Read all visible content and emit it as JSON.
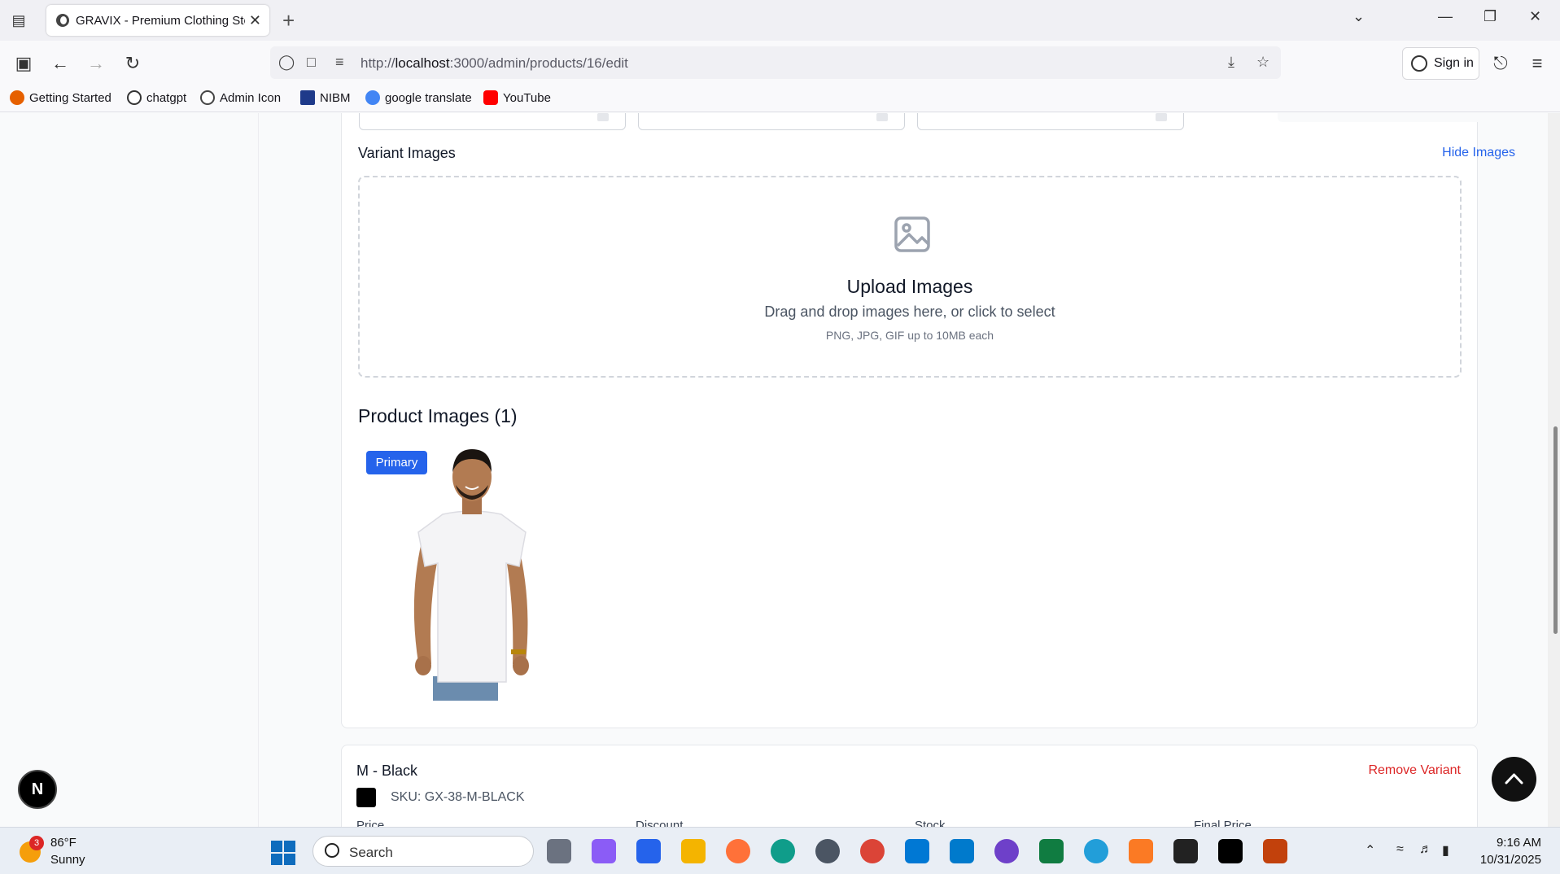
{
  "browser": {
    "tab_title": "GRAVIX - Premium Clothing Sto",
    "url_prefix": "http://",
    "url_host": "localhost",
    "url_path": ":3000/admin/products/16/edit",
    "sign_in": "Sign in",
    "bookmarks": [
      {
        "label": "Getting Started",
        "icon": "firefox-icon",
        "color": "#e66000"
      },
      {
        "label": "chatgpt",
        "icon": "openai-icon",
        "color": "#333333"
      },
      {
        "label": "Admin Icon",
        "icon": "globe-icon",
        "color": "#444444"
      },
      {
        "label": "NIBM",
        "icon": "nibm-icon",
        "color": "#1e3a8a"
      },
      {
        "label": "google translate",
        "icon": "google-icon",
        "color": "#4285f4"
      },
      {
        "label": "YouTube",
        "icon": "youtube-icon",
        "color": "#ff0000"
      }
    ]
  },
  "page": {
    "variant_images_title": "Variant Images",
    "hide_images_link": "Hide Images",
    "dropzone": {
      "title": "Upload Images",
      "subtitle": "Drag and drop images here, or click to select",
      "note": "PNG, JPG, GIF up to 10MB each"
    },
    "product_images_title": "Product Images (1)",
    "primary_badge": "Primary",
    "variant": {
      "name": "M - Black",
      "remove_link": "Remove Variant",
      "sku": "SKU: GX-38-M-BLACK",
      "swatch_color": "#000000",
      "columns": [
        "Price",
        "Discount",
        "Stock",
        "Final Price"
      ]
    },
    "next_badge": "N"
  },
  "taskbar": {
    "weather_badge": "3",
    "temperature": "86°F",
    "condition": "Sunny",
    "search_label": "Search",
    "time": "9:16 AM",
    "date": "10/31/2025",
    "apps": [
      {
        "name": "task-view-icon",
        "color": "#6b7280"
      },
      {
        "name": "copilot-icon",
        "color": "#8b5cf6"
      },
      {
        "name": "store-icon",
        "color": "#2563eb"
      },
      {
        "name": "file-explorer-icon",
        "color": "#f4b400"
      },
      {
        "name": "firefox-icon",
        "color": "#ff7139"
      },
      {
        "name": "edge-icon",
        "color": "#0f9d8a"
      },
      {
        "name": "settings-icon",
        "color": "#4b5563"
      },
      {
        "name": "chrome-icon",
        "color": "#db4437"
      },
      {
        "name": "photos-icon",
        "color": "#0078d4"
      },
      {
        "name": "vscode-icon",
        "color": "#007acc"
      },
      {
        "name": "github-icon",
        "color": "#6e40c9"
      },
      {
        "name": "excel-icon",
        "color": "#107c41"
      },
      {
        "name": "telegram-icon",
        "color": "#229ed9"
      },
      {
        "name": "xampp-icon",
        "color": "#fb7a24"
      },
      {
        "name": "terminal-icon",
        "color": "#222222"
      },
      {
        "name": "capcut-icon",
        "color": "#000000"
      },
      {
        "name": "snipping-icon",
        "color": "#c2410c"
      }
    ]
  }
}
